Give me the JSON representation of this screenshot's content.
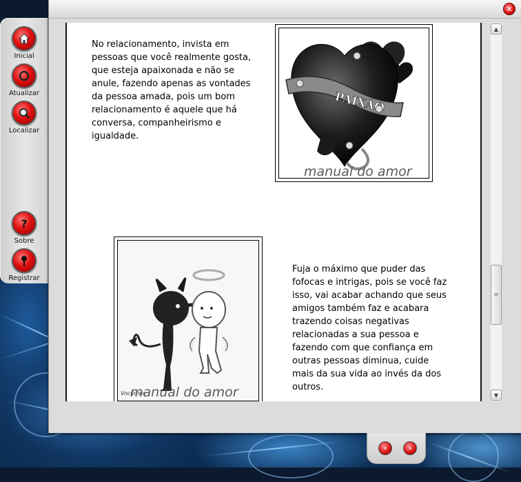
{
  "window": {
    "close_icon": "close-icon"
  },
  "toolbar": {
    "items": [
      {
        "label": "Inicial",
        "icon": "home-icon"
      },
      {
        "label": "Atualizar",
        "icon": "refresh-icon"
      },
      {
        "label": "Localizar",
        "icon": "search-icon"
      },
      {
        "label": "Sobre",
        "icon": "question-icon"
      },
      {
        "label": "Registrar",
        "icon": "pin-icon"
      }
    ]
  },
  "content": {
    "paragraph1": [
      "No relacionamento, invista em",
      "pessoas que você realmente gosta,",
      "que esteja apaixonada e não se",
      "anule, fazendo apenas as vontades",
      "da pessoa amada, pois um bom",
      "relacionamento é aquele que há",
      "conversa, companheirismo e",
      "igualdade."
    ],
    "paragraph2": [
      "Fuja o máximo que puder das",
      "fofocas e intrigas, pois se você faz",
      "isso, vai acabar achando que seus",
      "amigos também faz  e acabara",
      "trazendo coisas negativas",
      "relacionadas a sua pessoa e",
      "fazendo com que confiança em",
      "outras pessoas diminua, cuide",
      "mais da sua vida ao invés da dos",
      "outros."
    ],
    "image1": {
      "banner_text": "PAIXÃO",
      "watermark": "manual do amor"
    },
    "image2": {
      "watermark": "manual do amor",
      "signature": "Vocumes"
    }
  },
  "navigation": {
    "prev_icon": "arrow-left-icon",
    "next_icon": "arrow-right-icon"
  },
  "colors": {
    "accent": "#e01010",
    "panel": "#dcdcdc"
  }
}
